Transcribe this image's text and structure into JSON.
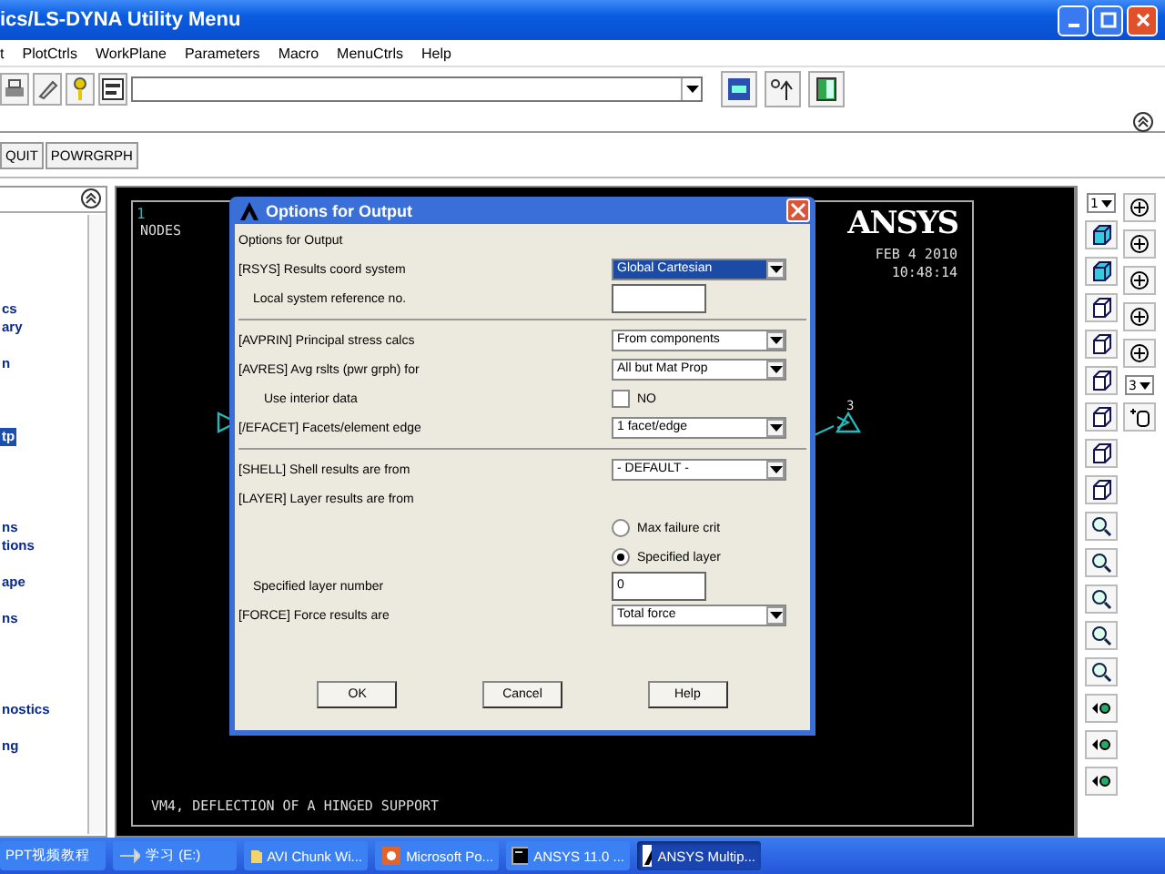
{
  "window": {
    "title": "ics/LS-DYNA Utility Menu"
  },
  "menu": [
    "t",
    "PlotCtrls",
    "WorkPlane",
    "Parameters",
    "Macro",
    "MenuCtrls",
    "Help"
  ],
  "toolbar_buttons": [
    "QUIT",
    "POWRGRPH"
  ],
  "sidebar": {
    "items": [
      {
        "label": "cs",
        "selected": false
      },
      {
        "label": "ary",
        "selected": false
      },
      {
        "label": "n",
        "selected": false
      },
      {
        "label": "tp",
        "selected": true
      },
      {
        "label": "ns",
        "selected": false
      },
      {
        "label": "tions",
        "selected": false
      },
      {
        "label": "ape",
        "selected": false
      },
      {
        "label": "ns",
        "selected": false
      },
      {
        "label": "nostics",
        "selected": false
      },
      {
        "label": "ng",
        "selected": false
      }
    ]
  },
  "graphics": {
    "window_number": "1",
    "plot_label": "NODES",
    "logo": "ANSYS",
    "date": "FEB  4 2010",
    "time": "10:48:14",
    "node_label": "3",
    "caption": "VM4, DEFLECTION OF A HINGED SUPPORT"
  },
  "right_toolbar": {
    "view_number": "1",
    "rotate_axis": "3"
  },
  "dialog": {
    "title": "Options for Output",
    "heading": "Options for Output",
    "sections": [
      [
        {
          "kind": "dropdown",
          "label": "[RSYS]  Results coord system",
          "value": "Global Cartesian",
          "highlighted": true
        },
        {
          "kind": "input",
          "label": "Local system reference no."
        }
      ],
      [
        {
          "kind": "dropdown",
          "label": "[AVPRIN]  Principal stress calcs",
          "value": "From components",
          "highlighted": false
        },
        {
          "kind": "dropdown",
          "label": "[AVRES]  Avg rslts (pwr grph) for",
          "value": "All but Mat Prop",
          "highlighted": false
        },
        {
          "kind": "checkbox",
          "label": "Use interior data",
          "value": "NO",
          "checked": false
        },
        {
          "kind": "dropdown",
          "label": "[/EFACET]  Facets/element edge",
          "value": "1 facet/edge",
          "highlighted": false
        }
      ],
      [
        {
          "kind": "dropdown",
          "label": "[SHELL]  Shell results are from",
          "value": "- DEFAULT -",
          "highlighted": false
        },
        {
          "kind": "label",
          "label": "[LAYER]  Layer results are from"
        },
        {
          "kind": "radio",
          "value": "Max failure crit",
          "selected": false
        },
        {
          "kind": "radio",
          "value": "Specified layer",
          "selected": true
        },
        {
          "kind": "input",
          "label": "Specified layer number",
          "value": "0"
        },
        {
          "kind": "dropdown",
          "label": "[FORCE]  Force results are",
          "value": "Total force",
          "highlighted": false
        }
      ]
    ],
    "buttons": [
      "OK",
      "Cancel",
      "Help"
    ]
  },
  "taskbar": {
    "items": [
      {
        "label": "PPT视频教程",
        "selected": false
      },
      {
        "label": "学习 (E:)",
        "selected": false
      },
      {
        "label": "AVI Chunk Wi...",
        "selected": false
      },
      {
        "label": "Microsoft Po...",
        "selected": false
      },
      {
        "label": "ANSYS 11.0 ...",
        "selected": false
      },
      {
        "label": "ANSYS Multip...",
        "selected": true
      }
    ]
  }
}
